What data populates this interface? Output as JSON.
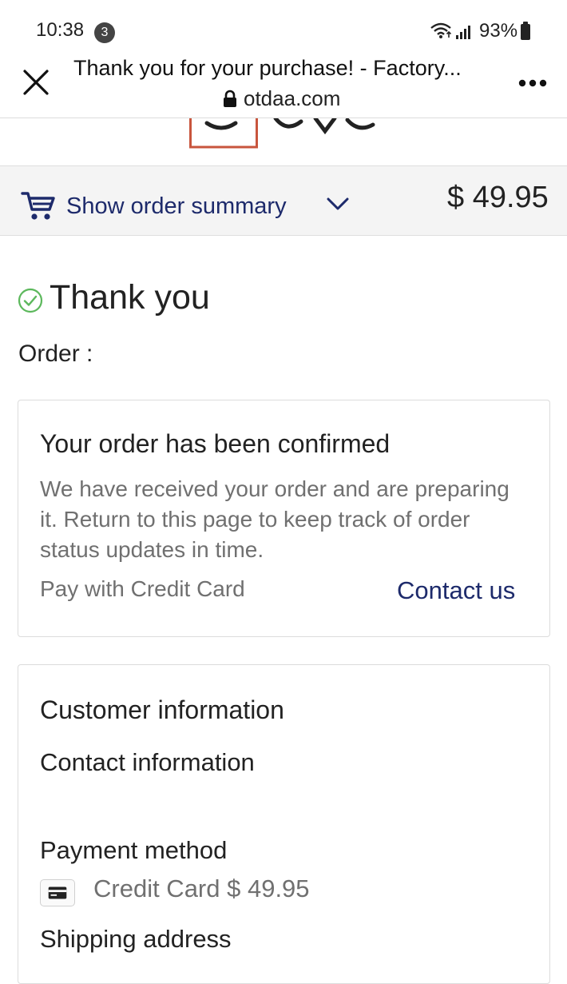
{
  "status_bar": {
    "time": "10:38",
    "notification_count": "3",
    "battery": "93%"
  },
  "browser": {
    "title": "Thank you for your purchase! - Factory...",
    "domain": "otdaa.com"
  },
  "order_summary": {
    "label": "Show order summary",
    "total": "$ 49.95"
  },
  "thanks": {
    "heading": "Thank you",
    "order_label": "Order :"
  },
  "confirmation": {
    "title": "Your order has been confirmed",
    "body": "We have received your order and are preparing it. Return to this page to keep track of order status updates in time.",
    "payment_text": "Pay with Credit Card",
    "contact_link": "Contact us"
  },
  "customer_info": {
    "title": "Customer information",
    "contact_heading": "Contact information",
    "payment_heading": "Payment method",
    "payment_detail": "Credit Card $ 49.95",
    "shipping_heading": "Shipping address"
  },
  "colors": {
    "accent_navy": "#1d2a6b",
    "check_green": "#5cb85c",
    "logo_border": "#c8553d"
  }
}
